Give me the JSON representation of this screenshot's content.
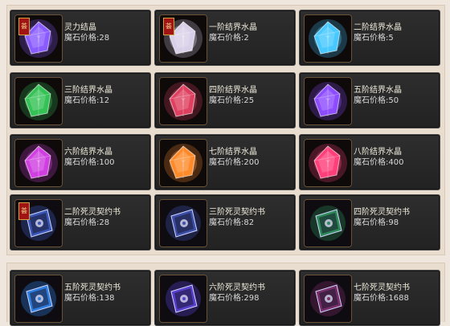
{
  "price_label": "魔石价格:",
  "items": [
    {
      "name": "灵力结晶",
      "price": "28",
      "icon": "spirit-crystal-icon",
      "color": "#8a5cff",
      "badge": "荟"
    },
    {
      "name": "一阶结界水晶",
      "price": "2",
      "icon": "crystal-tier-1-icon",
      "color": "#d8d0e8",
      "badge": "荟"
    },
    {
      "name": "二阶结界水晶",
      "price": "5",
      "icon": "crystal-tier-2-icon",
      "color": "#47c8ff"
    },
    {
      "name": "三阶结界水晶",
      "price": "12",
      "icon": "crystal-tier-3-icon",
      "color": "#35c255"
    },
    {
      "name": "四阶结界水晶",
      "price": "25",
      "icon": "crystal-tier-4-icon",
      "color": "#e04060"
    },
    {
      "name": "五阶结界水晶",
      "price": "50",
      "icon": "crystal-tier-5-icon",
      "color": "#8d4cff"
    },
    {
      "name": "六阶结界水晶",
      "price": "100",
      "icon": "crystal-tier-6-icon",
      "color": "#d040e0"
    },
    {
      "name": "七阶结界水晶",
      "price": "200",
      "icon": "crystal-tier-7-icon",
      "color": "#ff8a2a"
    },
    {
      "name": "八阶结界水晶",
      "price": "400",
      "icon": "crystal-tier-8-icon",
      "color": "#ff3f7a"
    },
    {
      "name": "二阶死灵契约书",
      "price": "28",
      "icon": "necro-book-tier-2-icon",
      "color": "#3b57b8",
      "badge": "荟"
    },
    {
      "name": "三阶死灵契约书",
      "price": "82",
      "icon": "necro-book-tier-3-icon",
      "color": "#3d4fa8"
    },
    {
      "name": "四阶死灵契约书",
      "price": "98",
      "icon": "necro-book-tier-4-icon",
      "color": "#2f8a5a"
    },
    {
      "name": "五阶死灵契约书",
      "price": "138",
      "icon": "necro-book-tier-5-icon",
      "color": "#2f7fe0"
    },
    {
      "name": "六阶死灵契约书",
      "price": "298",
      "icon": "necro-book-tier-6-icon",
      "color": "#5a3fcf"
    },
    {
      "name": "七阶死灵契约书",
      "price": "1688",
      "icon": "necro-book-tier-7-icon",
      "color": "#7a2f6a"
    }
  ]
}
